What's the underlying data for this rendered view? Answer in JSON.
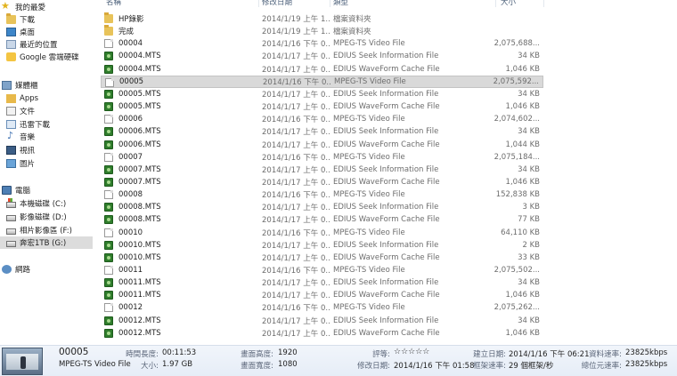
{
  "nav": {
    "favorites": {
      "label": "我的最愛",
      "items": [
        {
          "label": "下載",
          "icon": "download-folder-icon"
        },
        {
          "label": "桌面",
          "icon": "desktop-icon"
        },
        {
          "label": "最近的位置",
          "icon": "recent-places-icon"
        },
        {
          "label": "Google 雲端硬碟",
          "icon": "google-drive-icon"
        }
      ]
    },
    "libraries": {
      "label": "媒體櫃",
      "items": [
        {
          "label": "Apps",
          "icon": "folder-icon"
        },
        {
          "label": "文件",
          "icon": "documents-icon"
        },
        {
          "label": "迅雷下載",
          "icon": "download-icon"
        },
        {
          "label": "音樂",
          "icon": "music-icon"
        },
        {
          "label": "視訊",
          "icon": "video-icon"
        },
        {
          "label": "圖片",
          "icon": "pictures-icon"
        }
      ]
    },
    "computer": {
      "label": "電腦",
      "items": [
        {
          "label": "本機磁碟 (C:)",
          "icon": "system-drive-icon"
        },
        {
          "label": "影像磁碟 (D:)",
          "icon": "drive-icon"
        },
        {
          "label": "相片影像區 (F:)",
          "icon": "drive-icon"
        },
        {
          "label": "奔宏1TB (G:)",
          "icon": "drive-icon",
          "selected": true
        }
      ]
    },
    "network": {
      "label": "網路",
      "icon": "network-icon"
    }
  },
  "columns": {
    "name": "名稱",
    "date": "修改日期",
    "type": "類型",
    "size": "大小"
  },
  "files": [
    {
      "name": "HP錄影",
      "date": "2014/1/19 上午 1...",
      "type": "檔案資料夾",
      "size": "",
      "kind": "folder"
    },
    {
      "name": "完成",
      "date": "2014/1/19 上午 1...",
      "type": "檔案資料夾",
      "size": "",
      "kind": "folder"
    },
    {
      "name": "00004",
      "date": "2014/1/16 下午 0...",
      "type": "MPEG-TS Video File",
      "size": "2,075,688...",
      "kind": "doc"
    },
    {
      "name": "00004.MTS",
      "date": "2014/1/17 上午 0...",
      "type": "EDIUS Seek Information File",
      "size": "34 KB",
      "kind": "mts"
    },
    {
      "name": "00004.MTS",
      "date": "2014/1/17 上午 0...",
      "type": "EDIUS WaveForm Cache File",
      "size": "1,046 KB",
      "kind": "mts"
    },
    {
      "name": "00005",
      "date": "2014/1/16 下午 0...",
      "type": "MPEG-TS Video File",
      "size": "2,075,592...",
      "kind": "doc",
      "selected": true
    },
    {
      "name": "00005.MTS",
      "date": "2014/1/17 上午 0...",
      "type": "EDIUS Seek Information File",
      "size": "34 KB",
      "kind": "mts"
    },
    {
      "name": "00005.MTS",
      "date": "2014/1/17 上午 0...",
      "type": "EDIUS WaveForm Cache File",
      "size": "1,046 KB",
      "kind": "mts"
    },
    {
      "name": "00006",
      "date": "2014/1/16 下午 0...",
      "type": "MPEG-TS Video File",
      "size": "2,074,602...",
      "kind": "doc"
    },
    {
      "name": "00006.MTS",
      "date": "2014/1/17 上午 0...",
      "type": "EDIUS Seek Information File",
      "size": "34 KB",
      "kind": "mts"
    },
    {
      "name": "00006.MTS",
      "date": "2014/1/17 上午 0...",
      "type": "EDIUS WaveForm Cache File",
      "size": "1,044 KB",
      "kind": "mts"
    },
    {
      "name": "00007",
      "date": "2014/1/16 下午 0...",
      "type": "MPEG-TS Video File",
      "size": "2,075,184...",
      "kind": "doc"
    },
    {
      "name": "00007.MTS",
      "date": "2014/1/17 上午 0...",
      "type": "EDIUS Seek Information File",
      "size": "34 KB",
      "kind": "mts"
    },
    {
      "name": "00007.MTS",
      "date": "2014/1/17 上午 0...",
      "type": "EDIUS WaveForm Cache File",
      "size": "1,046 KB",
      "kind": "mts"
    },
    {
      "name": "00008",
      "date": "2014/1/16 下午 0...",
      "type": "MPEG-TS Video File",
      "size": "152,838 KB",
      "kind": "doc"
    },
    {
      "name": "00008.MTS",
      "date": "2014/1/17 上午 0...",
      "type": "EDIUS Seek Information File",
      "size": "3 KB",
      "kind": "mts"
    },
    {
      "name": "00008.MTS",
      "date": "2014/1/17 上午 0...",
      "type": "EDIUS WaveForm Cache File",
      "size": "77 KB",
      "kind": "mts"
    },
    {
      "name": "00010",
      "date": "2014/1/16 下午 0...",
      "type": "MPEG-TS Video File",
      "size": "64,110 KB",
      "kind": "doc"
    },
    {
      "name": "00010.MTS",
      "date": "2014/1/17 上午 0...",
      "type": "EDIUS Seek Information File",
      "size": "2 KB",
      "kind": "mts"
    },
    {
      "name": "00010.MTS",
      "date": "2014/1/17 上午 0...",
      "type": "EDIUS WaveForm Cache File",
      "size": "33 KB",
      "kind": "mts"
    },
    {
      "name": "00011",
      "date": "2014/1/16 下午 0...",
      "type": "MPEG-TS Video File",
      "size": "2,075,502...",
      "kind": "doc"
    },
    {
      "name": "00011.MTS",
      "date": "2014/1/17 上午 0...",
      "type": "EDIUS Seek Information File",
      "size": "34 KB",
      "kind": "mts"
    },
    {
      "name": "00011.MTS",
      "date": "2014/1/17 上午 0...",
      "type": "EDIUS WaveForm Cache File",
      "size": "1,046 KB",
      "kind": "mts"
    },
    {
      "name": "00012",
      "date": "2014/1/16 下午 0...",
      "type": "MPEG-TS Video File",
      "size": "2,075,262...",
      "kind": "doc"
    },
    {
      "name": "00012.MTS",
      "date": "2014/1/17 上午 0...",
      "type": "EDIUS Seek Information File",
      "size": "34 KB",
      "kind": "mts"
    },
    {
      "name": "00012.MTS",
      "date": "2014/1/17 上午 0...",
      "type": "EDIUS WaveForm Cache File",
      "size": "1,046 KB",
      "kind": "mts"
    }
  ],
  "details": {
    "file_name": "00005",
    "file_type": "MPEG-TS Video File",
    "length_label": "時間長度:",
    "length": "00:11:53",
    "size_label": "大小:",
    "size": "1.97 GB",
    "height_label": "畫面高度:",
    "height": "1920",
    "width_label": "畫面寬度:",
    "width": "1080",
    "rating_label": "評等:",
    "rating_stars": "☆☆☆☆☆",
    "modified_label": "修改日期:",
    "modified": "2014/1/16 下午 01:58",
    "created_label": "建立日期:",
    "created": "2014/1/16 下午 06:21",
    "framerate_label": "框架速率:",
    "framerate": "29 個框架/秒",
    "datarate_label": "資料速率:",
    "datarate": "23825kbps",
    "bitrate_label": "總位元速率:",
    "bitrate": "23825kbps"
  }
}
